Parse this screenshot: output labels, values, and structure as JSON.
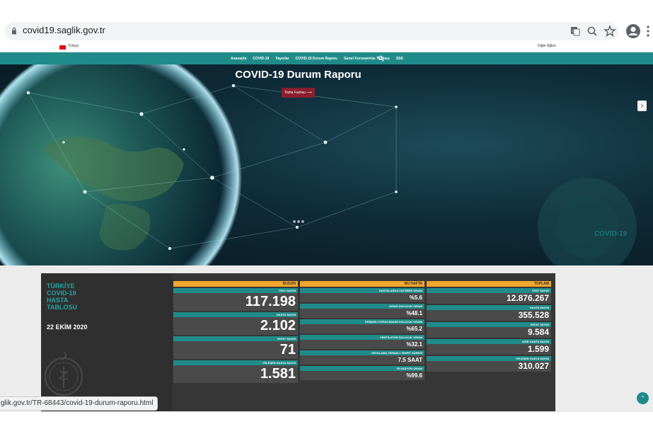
{
  "browser": {
    "url": "covid19.saglik.gov.tr"
  },
  "util_bar": {
    "language": "Türkçe",
    "right_link": "Diğer Ağları"
  },
  "nav": {
    "items": [
      "Anasayfa",
      "COVID-19",
      "Yayınlar",
      "COVID-19 Durum Raporu",
      "Genel Koronavirüs Tablosu",
      "SSS"
    ]
  },
  "hero": {
    "title": "COVID-19 Durum Raporu",
    "button_label": "Daha Fazlası",
    "watermark": "COVID-19"
  },
  "panel": {
    "heading_lines": [
      "TÜRKİYE",
      "COVID-19",
      "HASTA",
      "TABLOSU"
    ],
    "date": "22 EKİM 2020",
    "bugun": {
      "header": "BUGÜN",
      "metrics": [
        {
          "label": "TEST SAYISI",
          "value": "117.198"
        },
        {
          "label": "HASTA SAYISI",
          "value": "2.102"
        },
        {
          "label": "VEFAT SAYISI",
          "value": "71"
        },
        {
          "label": "İYİLEŞEN HASTA SAYISI",
          "value": "1.581"
        }
      ]
    },
    "bu_hafta": {
      "header": "BU HAFTA",
      "metrics": [
        {
          "label": "HASTALARDA ZATÜRRE ORANI",
          "value": "%5.6"
        },
        {
          "label": "YATAK DOLULUK ORANI",
          "value": "%48.1"
        },
        {
          "label": "ERİŞKİN YOĞUN BAKIM DOLULUK ORANI",
          "value": "%65.2"
        },
        {
          "label": "VENTİLATÖR DOLULUK ORANI",
          "value": "%32.1"
        },
        {
          "label": "ORTALAMA TEMASLI TESPİT SÜRESİ",
          "value": "7.5 SAAT"
        },
        {
          "label": "FİLYASYON ORANI",
          "value": "%99.6"
        }
      ]
    },
    "toplam": {
      "header": "TOPLAM",
      "metrics": [
        {
          "label": "TEST SAYISI",
          "value": "12.876.267"
        },
        {
          "label": "HASTA SAYISI",
          "value": "355.528"
        },
        {
          "label": "VEFAT SAYISI",
          "value": "9.584"
        },
        {
          "label": "AĞIR HASTA SAYISI",
          "value": "1.599"
        },
        {
          "label": "İYİLEŞEN HASTA SAYISI",
          "value": "310.027"
        }
      ]
    }
  },
  "status_bar": {
    "url": "glik.gov.tr/TR-68443/covid-19-durum-raporu.html"
  },
  "colors": {
    "teal": "#1f8c8a",
    "orange": "#f2a62b",
    "panel": "#363636",
    "button": "#8a1f2e"
  },
  "icons": [
    "lock-icon",
    "translate-icon",
    "zoom-icon",
    "star-icon",
    "profile-icon",
    "menu-icon",
    "search-icon",
    "arrow-right-icon",
    "emblem-icon",
    "scroll-top-icon"
  ]
}
